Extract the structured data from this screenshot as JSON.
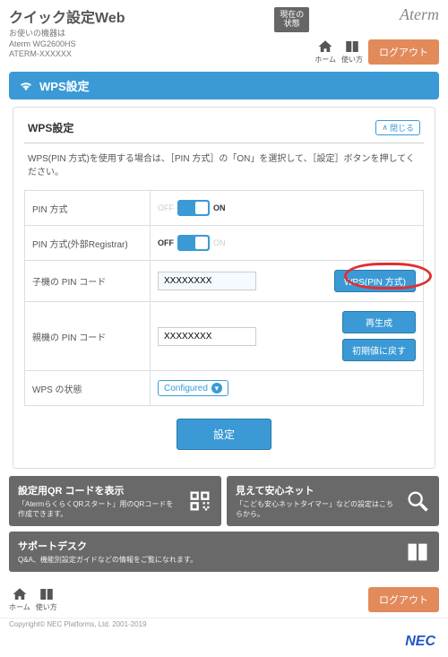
{
  "header": {
    "title": "クイック設定Web",
    "sub1": "お使いの機器は",
    "sub2": "Aterm WG2600HS",
    "sub3": "ATERM-XXXXXX",
    "status_badge": "現在の\n状態",
    "brand": "Aterm",
    "home_label": "ホーム",
    "guide_label": "使い方",
    "logout_label": "ログアウト"
  },
  "section": {
    "title": "WPS設定"
  },
  "panel": {
    "title": "WPS設定",
    "close_label": "閉じる",
    "description": "WPS(PIN 方式)を使用する場合は、［PIN 方式］の「ON」を選択して、［設定］ボタンを押してください。"
  },
  "rows": {
    "pin_method": {
      "label": "PIN 方式",
      "off": "OFF",
      "on": "ON",
      "state": "on"
    },
    "ext_registrar": {
      "label": "PIN 方式(外部Registrar)",
      "off": "OFF",
      "on": "ON",
      "state": "off"
    },
    "child_pin": {
      "label": "子機の PIN コード",
      "value": "XXXXXXXX",
      "action": "WPS(PIN 方式)"
    },
    "parent_pin": {
      "label": "親機の PIN コード",
      "value": "XXXXXXXX",
      "regen": "再生成",
      "reset": "初期値に戻す"
    },
    "wps_status": {
      "label": "WPS の状態",
      "value": "Configured"
    }
  },
  "submit_label": "設定",
  "cards": {
    "qr": {
      "title": "設定用QR コードを表示",
      "sub": "「AtermらくらくQRスタート」用のQRコードを作成できます。"
    },
    "net": {
      "title": "見えて安心ネット",
      "sub": "「こども安心ネットタイマー」などの設定はこちらから。"
    },
    "support": {
      "title": "サポートデスク",
      "sub": "Q&A、機能別設定ガイドなどの情報をご覧になれます。"
    }
  },
  "footer": {
    "copyright": "Copyright© NEC Platforms, Ltd. 2001-2019",
    "nec": "NEC"
  }
}
